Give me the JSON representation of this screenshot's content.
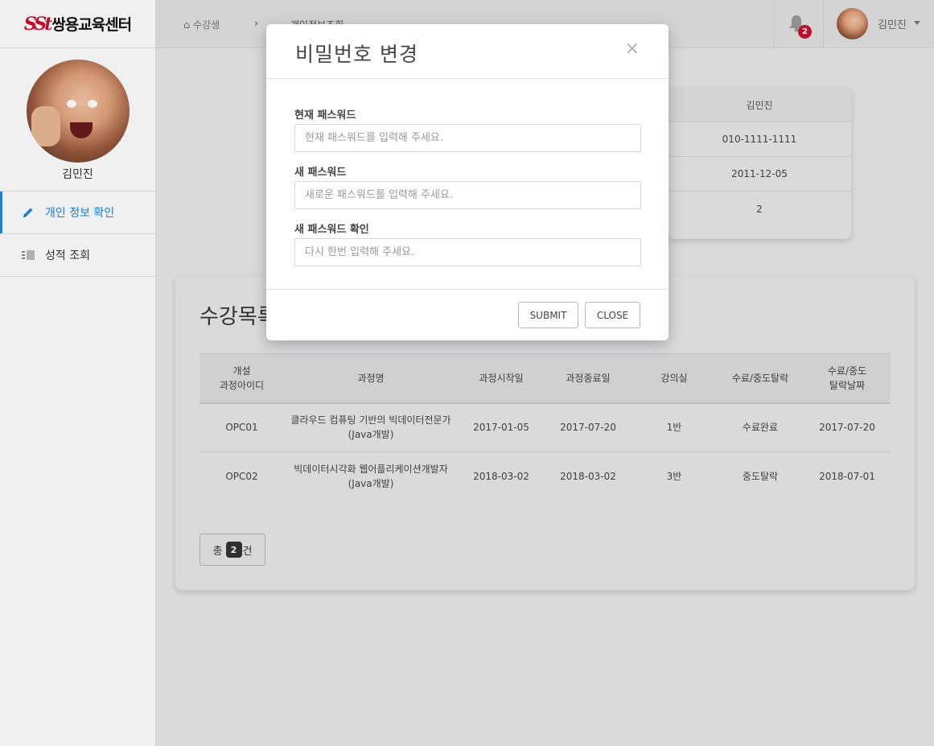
{
  "app": {
    "logo_mark": "SSt",
    "logo_text": "쌍용교육센터"
  },
  "sidebar": {
    "profile_name": "김민진",
    "items": [
      {
        "label": "개인 정보 확인",
        "icon": "pencil-icon",
        "active": true
      },
      {
        "label": "성적 조회",
        "icon": "list-icon",
        "active": false
      }
    ]
  },
  "topbar": {
    "breadcrumb": [
      "수강생",
      "개인정보조회"
    ],
    "breadcrumb_separator": "›",
    "notification_count": "2",
    "user_name": "김민진"
  },
  "info_card": {
    "rows": [
      "김민진",
      "010-1111-1111",
      "2011-12-05",
      "2"
    ]
  },
  "course_list": {
    "title": "수강목록",
    "headers": [
      "개설\n과정아이디",
      "과정명",
      "과정시작일",
      "과정종료일",
      "강의실",
      "수료/중도탈락",
      "수료/중도\n탈락날짜"
    ],
    "rows": [
      [
        "OPC01",
        "클라우드 컴퓨팅 기반의 빅데이터전문가(Java개발)",
        "2017-01-05",
        "2017-07-20",
        "1반",
        "수료완료",
        "2017-07-20"
      ],
      [
        "OPC02",
        "빅데이터시각화 웹어플리케이션개발자(Java개발)",
        "2018-03-02",
        "2018-03-02",
        "3반",
        "중도탈락",
        "2018-07-01"
      ]
    ],
    "total_prefix": "총",
    "total_count": "2",
    "total_suffix": "건"
  },
  "modal": {
    "title": "비밀번호 변경",
    "close_symbol": "×",
    "fields": [
      {
        "label": "현재 패스워드",
        "placeholder": "현재 패스워드를 입력해 주세요.",
        "value": ""
      },
      {
        "label": "새 패스워드",
        "placeholder": "새로운 패스워드를 입력해 주세요.",
        "value": ""
      },
      {
        "label": "새 패스워드 확인",
        "placeholder": "다시 한번 입력해 주세요.",
        "value": ""
      }
    ],
    "submit_label": "SUBMIT",
    "close_label": "CLOSE"
  },
  "colors": {
    "accent": "#1e88e5",
    "brand": "#c8102e",
    "badge": "#c8102e"
  }
}
